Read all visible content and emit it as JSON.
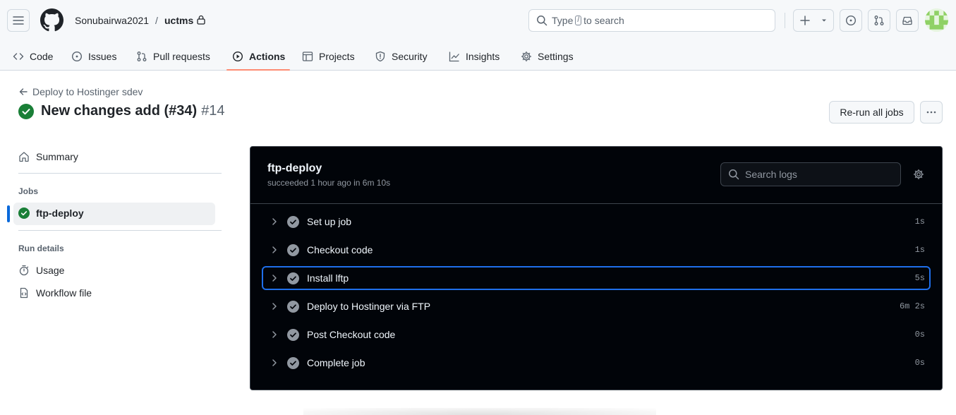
{
  "header": {
    "owner": "Sonubairwa2021",
    "separator": "/",
    "repo": "uctms",
    "search_pre": "Type",
    "search_key": "/",
    "search_post": "to search"
  },
  "tabs": [
    {
      "label": "Code",
      "icon": "code-icon"
    },
    {
      "label": "Issues",
      "icon": "issue-icon"
    },
    {
      "label": "Pull requests",
      "icon": "pull-request-icon"
    },
    {
      "label": "Actions",
      "icon": "play-icon",
      "active": true
    },
    {
      "label": "Projects",
      "icon": "table-icon"
    },
    {
      "label": "Security",
      "icon": "shield-icon"
    },
    {
      "label": "Insights",
      "icon": "graph-icon"
    },
    {
      "label": "Settings",
      "icon": "gear-icon"
    }
  ],
  "run": {
    "workflow_back": "Deploy to Hostinger sdev",
    "title": "New changes add (#34)",
    "number": "#14",
    "rerun_label": "Re-run all jobs"
  },
  "sidebar": {
    "summary": "Summary",
    "jobs_heading": "Jobs",
    "job": "ftp-deploy",
    "run_details_heading": "Run details",
    "usage": "Usage",
    "workflow_file": "Workflow file"
  },
  "log": {
    "job_name": "ftp-deploy",
    "job_status": "succeeded 1 hour ago in 6m 10s",
    "search_placeholder": "Search logs",
    "steps": [
      {
        "name": "Set up job",
        "time": "1s"
      },
      {
        "name": "Checkout code",
        "time": "1s"
      },
      {
        "name": "Install lftp",
        "time": "5s",
        "focused": true
      },
      {
        "name": "Deploy to Hostinger via FTP",
        "time": "6m 2s"
      },
      {
        "name": "Post Checkout code",
        "time": "0s"
      },
      {
        "name": "Complete job",
        "time": "0s"
      }
    ]
  },
  "colors": {
    "success": "#1a7f37",
    "step_check": "#9198a1",
    "active_tab_underline": "#fd8c73",
    "focus_ring": "#1f6feb",
    "panel_bg": "#010409"
  }
}
